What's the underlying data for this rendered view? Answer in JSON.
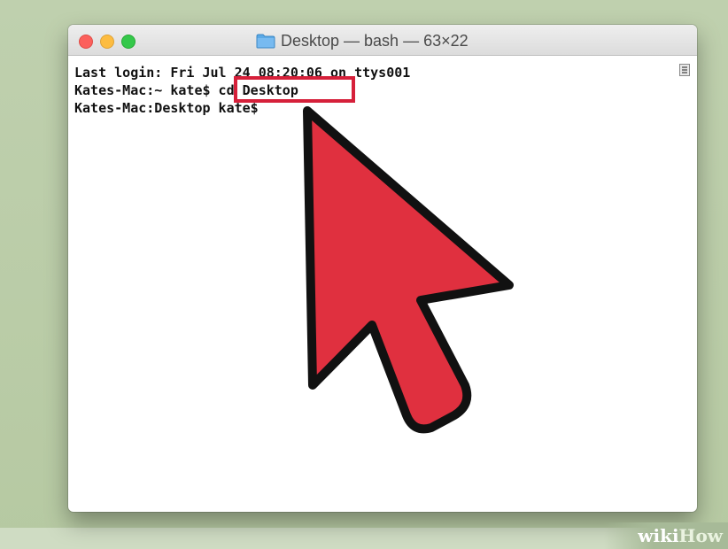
{
  "window": {
    "title": "Desktop — bash — 63×22"
  },
  "terminal": {
    "lines": [
      "Last login: Fri Jul 24 08:20:06 on ttys001",
      "Kates-Mac:~ kate$ cd Desktop",
      "Kates-Mac:Desktop kate$ "
    ]
  },
  "annotation": {
    "highlighted_command": "cd Desktop",
    "highlight_color": "#d6203a",
    "arrow_color": "#e0303f"
  },
  "watermark": {
    "brand_part1": "wiki",
    "brand_part2": "How"
  }
}
